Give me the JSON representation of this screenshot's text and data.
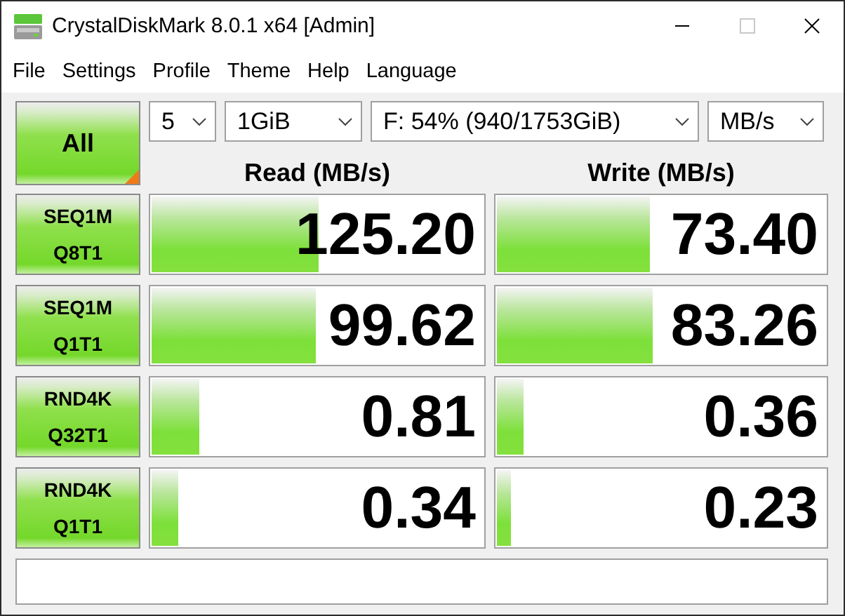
{
  "window": {
    "title": "CrystalDiskMark 8.0.1 x64 [Admin]",
    "controls": [
      {
        "kind": "minimize",
        "disabled": false
      },
      {
        "kind": "maximize",
        "disabled": true
      },
      {
        "kind": "close",
        "disabled": false
      }
    ]
  },
  "menu": [
    "File",
    "Settings",
    "Profile",
    "Theme",
    "Help",
    "Language"
  ],
  "all_button": {
    "label": "All"
  },
  "settings": [
    {
      "kind": "count",
      "value": "5"
    },
    {
      "kind": "size",
      "value": "1GiB"
    },
    {
      "kind": "drive",
      "value": "F: 54% (940/1753GiB)"
    },
    {
      "kind": "unit",
      "value": "MB/s"
    }
  ],
  "columns": [
    "Read (MB/s)",
    "Write (MB/s)"
  ],
  "tests": [
    {
      "name": "SEQ1M",
      "params": "Q8T1",
      "read": {
        "value": "125.20",
        "level": 0.51
      },
      "write": {
        "value": "73.40",
        "level": 0.47
      }
    },
    {
      "name": "SEQ1M",
      "params": "Q1T1",
      "read": {
        "value": "99.62",
        "level": 0.5
      },
      "write": {
        "value": "83.26",
        "level": 0.48
      }
    },
    {
      "name": "RND4K",
      "params": "Q32T1",
      "read": {
        "value": "0.81",
        "level": 0.15
      },
      "write": {
        "value": "0.36",
        "level": 0.09
      }
    },
    {
      "name": "RND4K",
      "params": "Q1T1",
      "read": {
        "value": "0.34",
        "level": 0.09
      },
      "write": {
        "value": "0.23",
        "level": 0.05
      }
    }
  ]
}
